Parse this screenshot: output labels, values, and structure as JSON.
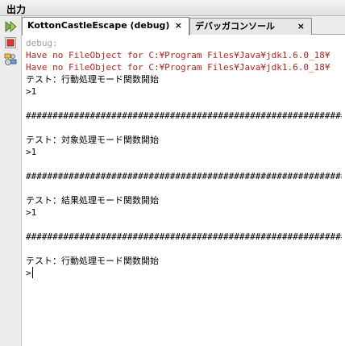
{
  "panel": {
    "title": "出力"
  },
  "tabs": [
    {
      "label": "KottonCastleEscape (debug)",
      "close": "×"
    },
    {
      "label": "デバッガコンソール",
      "close": "×"
    }
  ],
  "toolbar": {
    "run_icon": "rerun-icon",
    "stop_icon": "stop-icon",
    "settings_icon": "output-settings-icon",
    "colors": {
      "run": "#7ab43c",
      "stop": "#d83a2e"
    }
  },
  "output": {
    "lines": [
      {
        "text": "debug:",
        "style": "gray"
      },
      {
        "text": "Have no FileObject for C:¥Program Files¥Java¥jdk1.6.0_18¥",
        "style": "red"
      },
      {
        "text": "Have no FileObject for C:¥Program Files¥Java¥jdk1.6.0_18¥",
        "style": "red"
      },
      {
        "text": "テスト：行動処理モード関数開始",
        "style": "black jp"
      },
      {
        "text": ">1",
        "style": "black"
      },
      {
        "text": "",
        "style": "black"
      },
      {
        "text": "############################################################",
        "style": "black"
      },
      {
        "text": "",
        "style": "black"
      },
      {
        "text": "テスト：対象処理モード関数開始",
        "style": "black jp"
      },
      {
        "text": ">1",
        "style": "black"
      },
      {
        "text": "",
        "style": "black"
      },
      {
        "text": "############################################################",
        "style": "black"
      },
      {
        "text": "",
        "style": "black"
      },
      {
        "text": "テスト：結果処理モード関数開始",
        "style": "black jp"
      },
      {
        "text": ">1",
        "style": "black"
      },
      {
        "text": "",
        "style": "black"
      },
      {
        "text": "############################################################",
        "style": "black"
      },
      {
        "text": "",
        "style": "black"
      },
      {
        "text": "テスト：行動処理モード関数開始",
        "style": "black jp"
      },
      {
        "text": ">",
        "style": "black"
      }
    ]
  }
}
